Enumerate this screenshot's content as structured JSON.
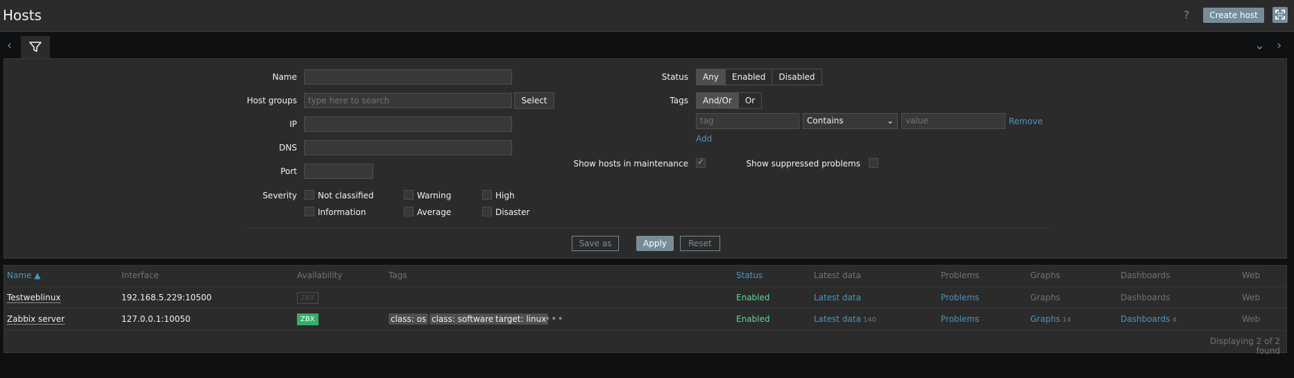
{
  "header": {
    "title": "Hosts",
    "help_icon": "?",
    "create_label": "Create host",
    "kiosk_icon": "fullscreen-icon"
  },
  "filter": {
    "name_label": "Name",
    "name_value": "",
    "hostgroups_label": "Host groups",
    "hostgroups_placeholder": "type here to search",
    "select_label": "Select",
    "ip_label": "IP",
    "dns_label": "DNS",
    "port_label": "Port",
    "severity_label": "Severity",
    "severities": [
      "Not classified",
      "Warning",
      "High",
      "Information",
      "Average",
      "Disaster"
    ],
    "status_label": "Status",
    "status_options": [
      "Any",
      "Enabled",
      "Disabled"
    ],
    "status_selected": "Any",
    "tags_label": "Tags",
    "tags_options": [
      "And/Or",
      "Or"
    ],
    "tags_selected": "And/Or",
    "tag_placeholder": "tag",
    "operator_value": "Contains",
    "value_placeholder": "value",
    "remove_label": "Remove",
    "add_label": "Add",
    "maintenance_label": "Show hosts in maintenance",
    "maintenance_checked": true,
    "suppressed_label": "Show suppressed problems",
    "suppressed_checked": false,
    "saveas_label": "Save as",
    "apply_label": "Apply",
    "reset_label": "Reset"
  },
  "table": {
    "columns": [
      "Name ▲",
      "Interface",
      "Availability",
      "Tags",
      "Status",
      "Latest data",
      "Problems",
      "Graphs",
      "Dashboards",
      "Web"
    ],
    "rows": [
      {
        "name": "Testweblinux",
        "interface": "192.168.5.229:10500",
        "availability": "ZBX",
        "tags": [],
        "status": "Enabled",
        "latest": "Latest data",
        "latest_count": "",
        "problems": "Problems",
        "graphs": "Graphs",
        "graphs_count": "",
        "dashboards": "Dashboards",
        "dashboards_count": "",
        "web": "Web"
      },
      {
        "name": "Zabbix server",
        "interface": "127.0.0.1:10050",
        "availability": "ZBX",
        "tags": [
          "class: os",
          "class: software",
          "target: linux"
        ],
        "more": "•••",
        "status": "Enabled",
        "latest": "Latest data",
        "latest_count": "140",
        "problems": "Problems",
        "graphs": "Graphs",
        "graphs_count": "14",
        "dashboards": "Dashboards",
        "dashboards_count": "4",
        "web": "Web"
      }
    ],
    "footer": "Displaying 2 of 2 found"
  },
  "colors": {
    "accent": "#768d99",
    "link": "#4796c4",
    "enabled": "#59db8f",
    "zbx_ok": "#34af67"
  }
}
